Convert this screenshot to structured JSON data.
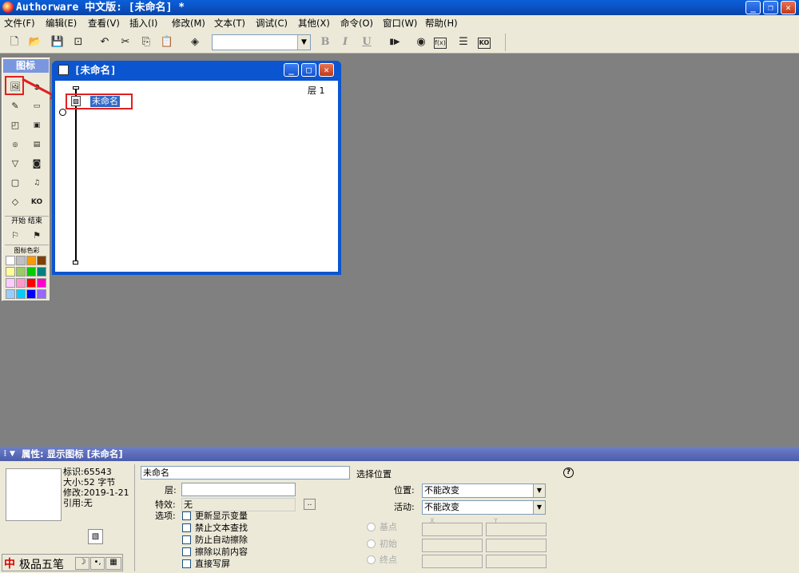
{
  "window": {
    "title": "Authorware 中文版: [未命名] *"
  },
  "menu": [
    "文件(F)",
    "编辑(E)",
    "查看(V)",
    "插入(I)",
    "修改(M)",
    "文本(T)",
    "调试(C)",
    "其他(X)",
    "命令(O)",
    "窗口(W)",
    "帮助(H)"
  ],
  "toolbar": {
    "icons": [
      "new-file-icon",
      "open-icon",
      "save-all-icon",
      "import-icon",
      "undo-icon",
      "cut-icon",
      "copy-icon",
      "paste-icon",
      "find-icon",
      "bold-icon",
      "italic-icon",
      "underline-icon",
      "run-icon",
      "control-panel-icon",
      "functions-icon",
      "variables-icon",
      "knowledge-objects-icon"
    ],
    "font_combo_value": "",
    "bold": "B",
    "italic": "I",
    "underline": "U"
  },
  "palette": {
    "title": "图标",
    "icons": [
      "display-icon",
      "motion-icon",
      "erase-icon",
      "wait-icon",
      "navigate-icon",
      "framework-icon",
      "decision-icon",
      "interaction-icon",
      "calculation-icon",
      "map-icon",
      "digital-movie-icon",
      "sound-icon",
      "video-icon",
      "knowledge-object-icon"
    ],
    "start_end_label": "开始 结束",
    "color_label": "图标色彩",
    "colors": [
      "#ffffff",
      "#c0c0c0",
      "#ff9900",
      "#804000",
      "#ffff99",
      "#99cc66",
      "#00cc00",
      "#008080",
      "#ffccff",
      "#ff99cc",
      "#ff0000",
      "#ff00cc",
      "#99ccff",
      "#00ccff",
      "#0000ff",
      "#9966ff"
    ]
  },
  "flowline": {
    "window_title": "[未命名]",
    "level": "层 1",
    "icon_label": "未命名"
  },
  "properties": {
    "header": "属性: 显示图标 [未命名]",
    "info": [
      "标识:65543",
      "大小:52 字节",
      "修改:2019-1-21",
      "引用:无"
    ],
    "name_value": "未命名",
    "layer_label": "层:",
    "layer_value": "",
    "effect_label": "特效:",
    "effect_value": "无",
    "effect_button": "..",
    "options_label": "选项:",
    "options": [
      "更新显示变量",
      "禁止文本查找",
      "防止自动擦除",
      "擦除以前内容",
      "直接写屏"
    ],
    "select_position_label": "选择位置",
    "position_label": "位置:",
    "position_value": "不能改变",
    "activity_label": "活动:",
    "activity_value": "不能改变",
    "radio_labels": [
      "基点",
      "初始",
      "终点"
    ],
    "xy_labels": [
      "X",
      "Y"
    ],
    "help": "?"
  },
  "ime": {
    "label": "极品五笔",
    "logo": "中"
  }
}
